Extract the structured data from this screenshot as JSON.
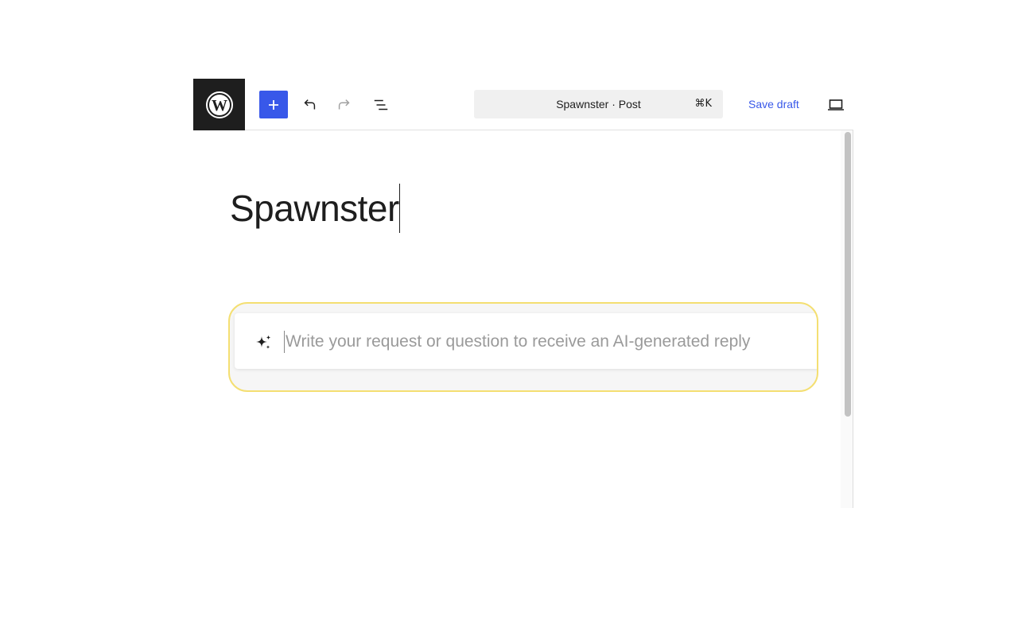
{
  "toolbar": {
    "logo_icon": "wordpress-logo-icon",
    "add_block_icon": "plus-icon",
    "undo_icon": "undo-icon",
    "redo_icon": "redo-icon",
    "list_view_icon": "list-view-icon",
    "accent_color": "#3858e9",
    "command_bar": {
      "title": "Spawnster · Post",
      "shortcut": "⌘K"
    },
    "save_draft_label": "Save draft",
    "preview_icon": "laptop-icon"
  },
  "editor": {
    "post_title": "Spawnster",
    "ai_prompt": {
      "icon": "sparkle-icon",
      "placeholder": "Write your request or question to receive an AI-generated reply",
      "value": "",
      "highlight_color": "#f4df72"
    }
  }
}
